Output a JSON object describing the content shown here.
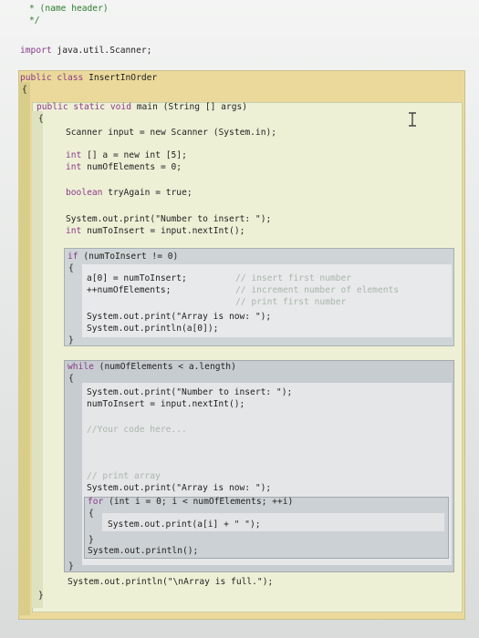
{
  "code": {
    "header_comment": "* (name header)",
    "header_close": "*/",
    "import_kw": "import",
    "import_rest": " java.util.Scanner;",
    "class_kw": "public class",
    "class_name": " InsertInOrder",
    "open_brace": "{",
    "close_brace": "}",
    "main_kw": "public static void",
    "main_rest": " main (String [] args)",
    "scanner_line": "Scanner input = new Scanner (System.in);",
    "int_kw": "int",
    "array_decl": " [] a = new int [5];",
    "count_decl": " numOfElements = 0;",
    "bool_kw": "boolean",
    "bool_rest": " tryAgain = true;",
    "print_insert": "System.out.print(\"Number to insert: \");",
    "read_decl": " numToInsert = input.nextInt();",
    "if_kw": "if",
    "if_rest": " (numToInsert != 0)",
    "assign_first": "a[0] = numToInsert;",
    "increment": "++numOfElements;",
    "cm_insert_first": "// insert first number",
    "cm_increment": "// increment number of elements",
    "cm_print_first": "// print first number",
    "print_array_now": "System.out.print(\"Array is now: \");",
    "println_a0": "System.out.println(a[0]);",
    "while_kw": "while",
    "while_rest": " (numOfElements < a.length)",
    "while_print": "System.out.print(\"Number to insert: \");",
    "while_read": "numToInsert = input.nextInt();",
    "cm_your_code": "//Your code here...",
    "cm_print_array": "// print array",
    "while_print_now": "System.out.print(\"Array is now: \");",
    "for_kw": "for",
    "for_rest": " (int i = 0; i < numOfElements; ++i)",
    "for_body": "System.out.print(a[i] + \" \");",
    "println_empty": "System.out.println();",
    "println_full": "System.out.println(\"\\nArray is full.\");"
  },
  "colors": {
    "class_block": "#ead99a",
    "method_block": "#eef0d6",
    "if_block": "#cfd4d6",
    "while_block": "#c7ccd0",
    "keyword": "#8a3a8a",
    "comment": "#2f7a2f"
  },
  "icons": {
    "cursor": "text-cursor-icon"
  }
}
